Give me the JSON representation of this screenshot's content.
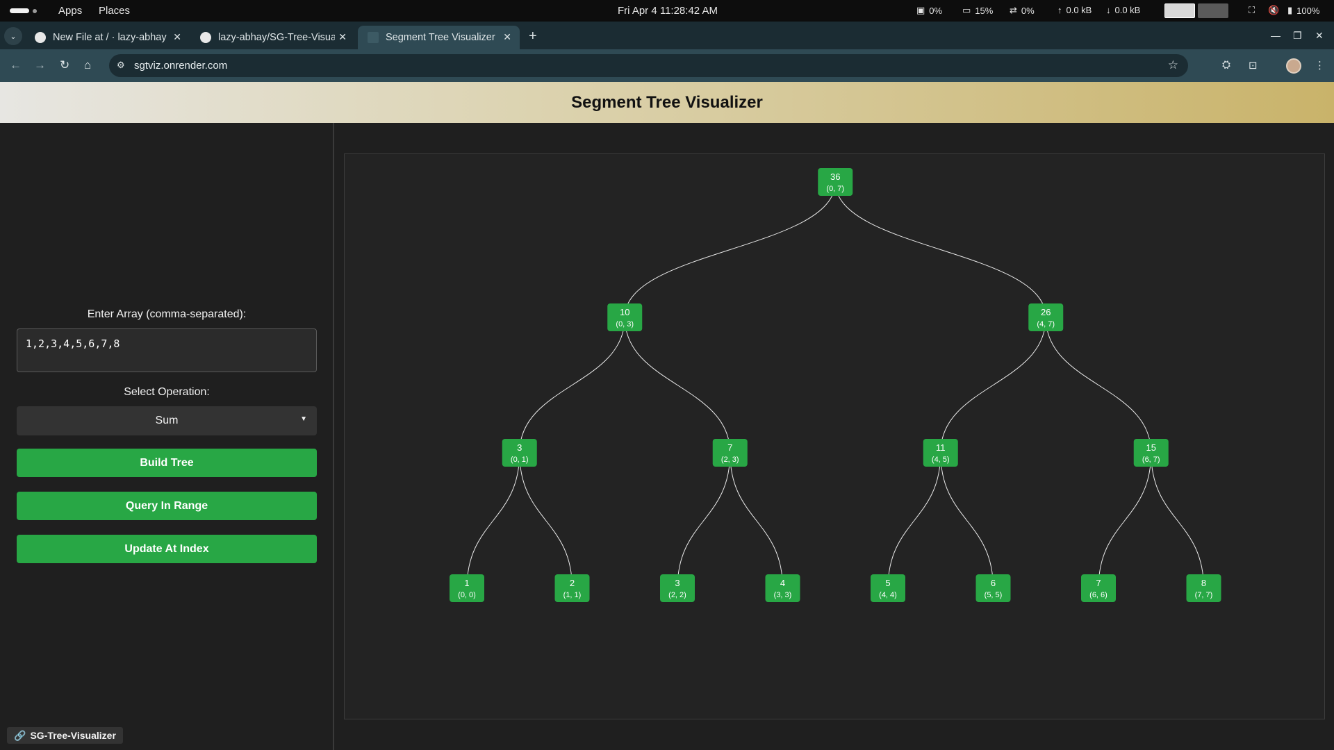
{
  "system_bar": {
    "apps_label": "Apps",
    "places_label": "Places",
    "clock": "Fri Apr 4  11:28:42 AM",
    "cpu": "0%",
    "memory": "15%",
    "swap": "0%",
    "upload": "0.0 kB",
    "download": "0.0 kB",
    "battery": "100%"
  },
  "browser": {
    "tabs": [
      {
        "title": "New File at / · lazy-abhay",
        "active": false
      },
      {
        "title": "lazy-abhay/SG-Tree-Visua",
        "active": false
      },
      {
        "title": "Segment Tree Visualizer",
        "active": true
      }
    ],
    "url": "sgtviz.onrender.com"
  },
  "app": {
    "title": "Segment Tree Visualizer",
    "array_label": "Enter Array (comma-separated):",
    "array_value": "1,2,3,4,5,6,7,8",
    "operation_label": "Select Operation:",
    "operation_value": "Sum",
    "build_button": "Build Tree",
    "query_button": "Query In Range",
    "update_button": "Update At Index",
    "repo_link": "SG-Tree-Visualizer"
  },
  "tree": {
    "input_array": [
      1,
      2,
      3,
      4,
      5,
      6,
      7,
      8
    ],
    "operation": "sum",
    "node_color": "#28a745",
    "edge_color": "#e8e8e8",
    "nodes": [
      {
        "id": 1,
        "value": "36",
        "range": "(0, 7)"
      },
      {
        "id": 2,
        "value": "10",
        "range": "(0, 3)"
      },
      {
        "id": 3,
        "value": "26",
        "range": "(4, 7)"
      },
      {
        "id": 4,
        "value": "3",
        "range": "(0, 1)"
      },
      {
        "id": 5,
        "value": "7",
        "range": "(2, 3)"
      },
      {
        "id": 6,
        "value": "11",
        "range": "(4, 5)"
      },
      {
        "id": 7,
        "value": "15",
        "range": "(6, 7)"
      },
      {
        "id": 8,
        "value": "1",
        "range": "(0, 0)"
      },
      {
        "id": 9,
        "value": "2",
        "range": "(1, 1)"
      },
      {
        "id": 10,
        "value": "3",
        "range": "(2, 2)"
      },
      {
        "id": 11,
        "value": "4",
        "range": "(3, 3)"
      },
      {
        "id": 12,
        "value": "5",
        "range": "(4, 4)"
      },
      {
        "id": 13,
        "value": "6",
        "range": "(5, 5)"
      },
      {
        "id": 14,
        "value": "7",
        "range": "(6, 6)"
      },
      {
        "id": 15,
        "value": "8",
        "range": "(7, 7)"
      }
    ]
  }
}
